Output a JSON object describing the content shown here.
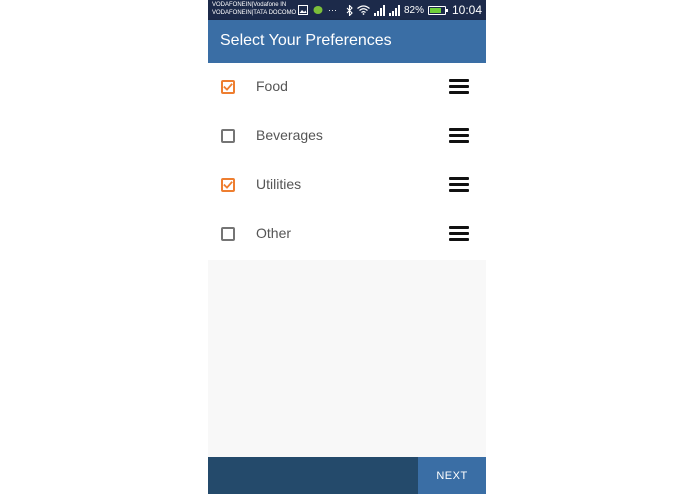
{
  "status_bar": {
    "carrier_line1": "VODAFONEIN|Vodafone IN",
    "carrier_line2": "VODAFONEIN|TATA DOCOMO",
    "overflow": "···",
    "battery_percent": "82%",
    "battery_level": 0.82,
    "time": "10:04",
    "icons": [
      "image-icon",
      "android-icon",
      "bluetooth-icon",
      "wifi-icon",
      "signal-icon",
      "signal-icon",
      "battery-icon"
    ]
  },
  "toolbar": {
    "title": "Select Your Preferences"
  },
  "preferences": [
    {
      "label": "Food",
      "checked": true
    },
    {
      "label": "Beverages",
      "checked": false
    },
    {
      "label": "Utilities",
      "checked": true
    },
    {
      "label": "Other",
      "checked": false
    }
  ],
  "footer": {
    "next_label": "NEXT"
  },
  "colors": {
    "status_bar": "#1c2a4a",
    "toolbar": "#3a6ea5",
    "checkbox_checked": "#ee7e30",
    "bottom_bar": "#244a6b",
    "next_button": "#3a6ea5"
  }
}
